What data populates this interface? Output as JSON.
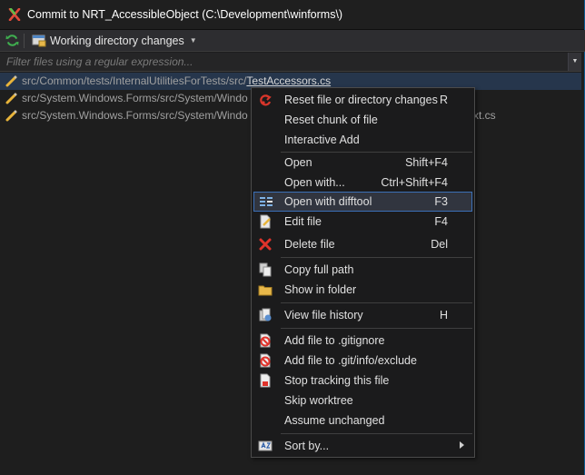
{
  "window": {
    "title": "Commit to NRT_AccessibleObject (C:\\Development\\winforms\\)",
    "icon": "git-commit-icon",
    "accent": "#0d5c91"
  },
  "toolbar": {
    "refresh_icon": "refresh-icon",
    "working_dir_label": "Working directory changes"
  },
  "filter": {
    "placeholder": "Filter files using a regular expression...",
    "value": ""
  },
  "files": [
    {
      "dir": "src/Common/tests/InternalUtilitiesForTests/src/",
      "name": "TestAccessors.cs",
      "selected": true
    },
    {
      "dir": "src/System.Windows.Forms/src/System/Windo",
      "name": "",
      "selected": false
    },
    {
      "dir": "src/System.Windows.Forms/src/System/Windo",
      "name": "",
      "selected": false
    }
  ],
  "file_row3_tail": "xt.cs",
  "context_menu": {
    "items": [
      {
        "label": "Reset file or directory changes",
        "shortcut": "R",
        "icon": "reset-icon"
      },
      {
        "label": "Reset chunk of file",
        "shortcut": "",
        "icon": ""
      },
      {
        "label": "Interactive Add",
        "shortcut": "",
        "icon": ""
      },
      {
        "label": "Open",
        "shortcut": "Shift+F4",
        "icon": ""
      },
      {
        "label": "Open with...",
        "shortcut": "Ctrl+Shift+F4",
        "icon": ""
      },
      {
        "label": "Open with difftool",
        "shortcut": "F3",
        "icon": "difftool-icon",
        "highlighted": true
      },
      {
        "label": "Edit file",
        "shortcut": "F4",
        "icon": "edit-file-icon"
      },
      {
        "label": "Delete file",
        "shortcut": "Del",
        "icon": "delete-icon"
      },
      {
        "label": "Copy full path",
        "shortcut": "",
        "icon": "copy-icon"
      },
      {
        "label": "Show in folder",
        "shortcut": "",
        "icon": "folder-icon"
      },
      {
        "label": "View file history",
        "shortcut": "H",
        "icon": "history-icon"
      },
      {
        "label": "Add file to .gitignore",
        "shortcut": "",
        "icon": "ignore-icon"
      },
      {
        "label": "Add file to .git/info/exclude",
        "shortcut": "",
        "icon": "exclude-icon"
      },
      {
        "label": "Stop tracking this file",
        "shortcut": "",
        "icon": "stop-tracking-icon"
      },
      {
        "label": "Skip worktree",
        "shortcut": "",
        "icon": ""
      },
      {
        "label": "Assume unchanged",
        "shortcut": "",
        "icon": ""
      },
      {
        "label": "Sort by...",
        "shortcut": "",
        "icon": "sort-icon",
        "submenu": true
      }
    ]
  }
}
